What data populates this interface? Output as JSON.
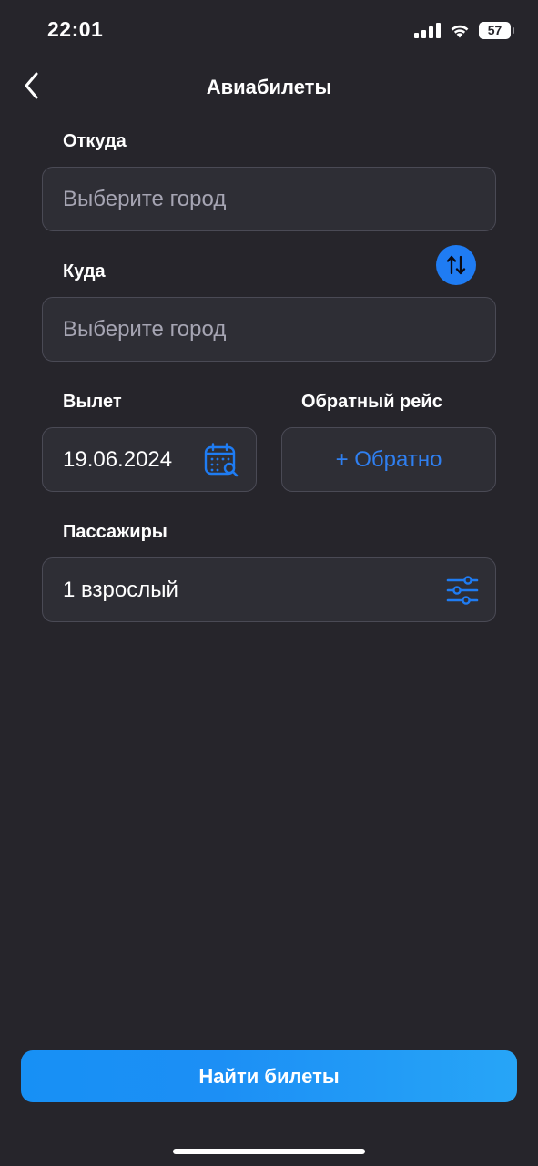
{
  "status_bar": {
    "time": "22:01",
    "battery": "57",
    "icons": [
      "cellular-signal-icon",
      "wifi-icon",
      "battery-icon"
    ]
  },
  "nav": {
    "back_icon": "chevron-left-icon",
    "title": "Авиабилеты"
  },
  "form": {
    "from": {
      "label": "Откуда",
      "placeholder": "Выберите город"
    },
    "to": {
      "label": "Куда",
      "placeholder": "Выберите город"
    },
    "swap_icon": "swap-arrows-icon",
    "departure": {
      "label": "Вылет",
      "value": "19.06.2024",
      "icon": "calendar-search-icon"
    },
    "return": {
      "label": "Обратный рейс",
      "button": "+ Обратно"
    },
    "passengers": {
      "label": "Пассажиры",
      "value": "1 взрослый",
      "icon": "sliders-icon"
    }
  },
  "actions": {
    "search": "Найти билеты"
  },
  "colors": {
    "background": "#26252b",
    "field": "#2e2e35",
    "accent": "#1f7cf3",
    "placeholder": "#a6a5b3"
  }
}
